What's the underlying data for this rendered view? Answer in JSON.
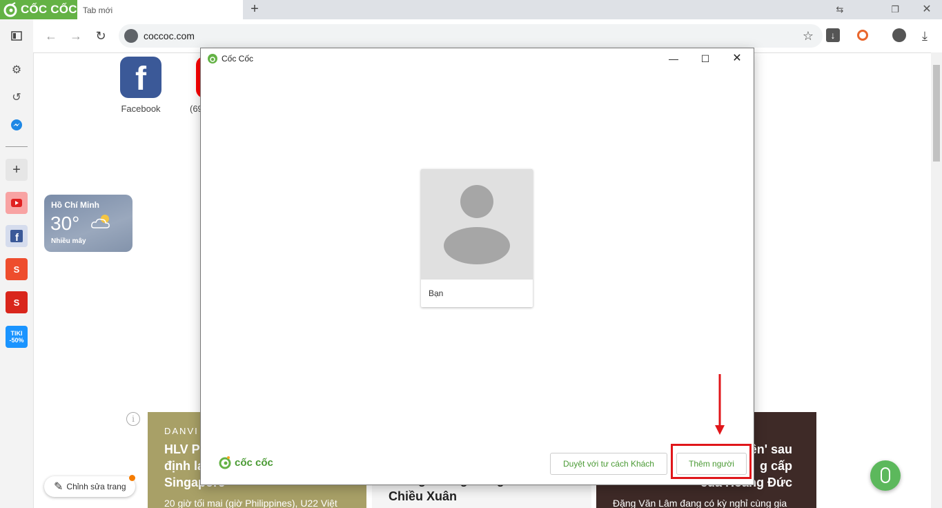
{
  "browser": {
    "brand": "CỐC CỐC",
    "tab_title": "Tab mới",
    "url": "coccoc.com"
  },
  "speed_dial": [
    {
      "label": "Facebook"
    },
    {
      "label": "(69"
    }
  ],
  "weather": {
    "city": "Hồ Chí Minh",
    "temp": "30°",
    "desc": "Nhiều mây"
  },
  "news": [
    {
      "source": "DANVI",
      "headline": "HLV P\nđịnh lạ\nSingapore",
      "summary": "20 giờ tối mai (giờ Philippines), U22 Việt"
    },
    {
      "headline": "bất ngờ bằng con gái NSƯT\nChiều Xuân"
    },
    {
      "headline": "iền' sau\ng cấp\ncủa Hoàng Đức",
      "summary": "Đặng Văn Lâm đang có kỳ nghỉ cùng gia"
    }
  ],
  "edit_page": "Chỉnh sửa trang",
  "dialog": {
    "title": "Cốc Cốc",
    "profile_name": "Bạn",
    "brand": "cốc cốc",
    "guest_button": "Duyệt với tư cách Khách",
    "add_person_button": "Thêm người"
  },
  "colors": {
    "brand_green": "#64b245",
    "annotation_red": "#e0161a"
  }
}
